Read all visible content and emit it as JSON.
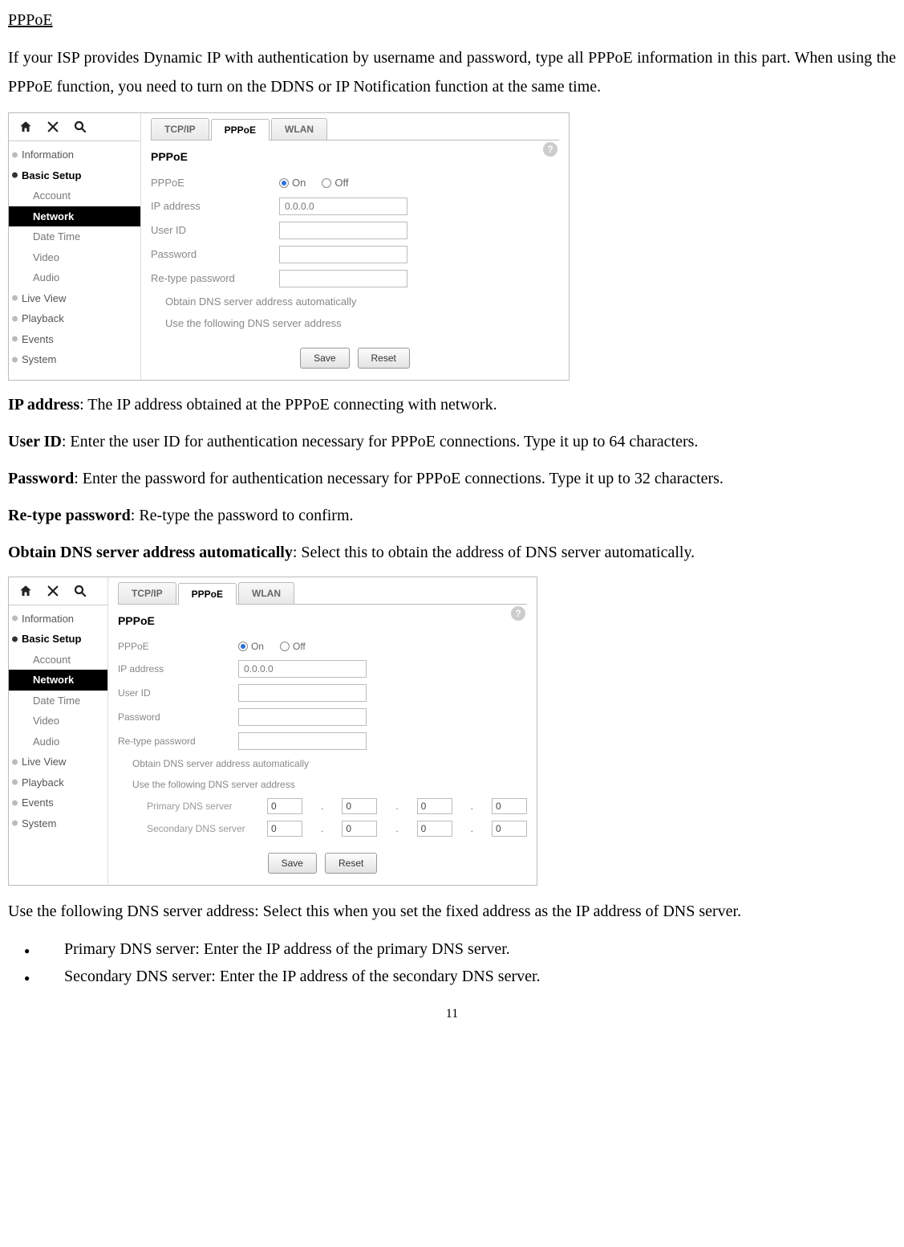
{
  "heading": "PPPoE",
  "intro": "If your ISP provides Dynamic IP with authentication by username and password, type all PPPoE information in this part. When using the PPPoE function, you need to turn on the DDNS or IP Notification function at the same time.",
  "defs": {
    "ip_addr": {
      "label": "IP address",
      "text": ": The IP address obtained at the PPPoE connecting with network."
    },
    "user_id": {
      "label": "User ID",
      "text": ": Enter the user ID for authentication necessary for PPPoE connections. Type it up to 64 characters."
    },
    "password": {
      "label": "Password",
      "text": ": Enter the password for authentication necessary for PPPoE connections. Type it up to 32 characters."
    },
    "retype": {
      "label": "Re-type password",
      "text": ": Re-type the password to confirm."
    },
    "obtain_dns": {
      "label": "Obtain DNS server address automatically",
      "text": ": Select this to obtain the address of DNS server automatically."
    },
    "use_dns": {
      "label": "Use the following DNS server address",
      "text": ": Select this when you set the fixed address as the IP address of DNS server."
    }
  },
  "bullets": {
    "primary": "Primary DNS server: Enter the IP address of the primary DNS server.",
    "secondary": "Secondary DNS server: Enter the IP address of the secondary DNS server."
  },
  "page_number": "11",
  "ui": {
    "nav": {
      "information": "Information",
      "basic_setup": "Basic Setup",
      "account": "Account",
      "network": "Network",
      "date_time": "Date Time",
      "video": "Video",
      "audio": "Audio",
      "live_view": "Live View",
      "playback": "Playback",
      "events": "Events",
      "system": "System"
    },
    "tabs": {
      "tcpip": "TCP/IP",
      "pppoe": "PPPoE",
      "wlan": "WLAN"
    },
    "panel": {
      "title": "PPPoE",
      "pppoe_label": "PPPoE",
      "on": "On",
      "off": "Off",
      "ip_label": "IP address",
      "ip_placeholder": "0.0.0.0",
      "userid_label": "User ID",
      "password_label": "Password",
      "retype_label": "Re-type password",
      "dns_auto": "Obtain DNS server address automatically",
      "dns_manual": "Use the following DNS server address",
      "primary_dns": "Primary DNS server",
      "secondary_dns": "Secondary DNS server",
      "ip_octet": "0",
      "help": "?",
      "save": "Save",
      "reset": "Reset"
    }
  }
}
